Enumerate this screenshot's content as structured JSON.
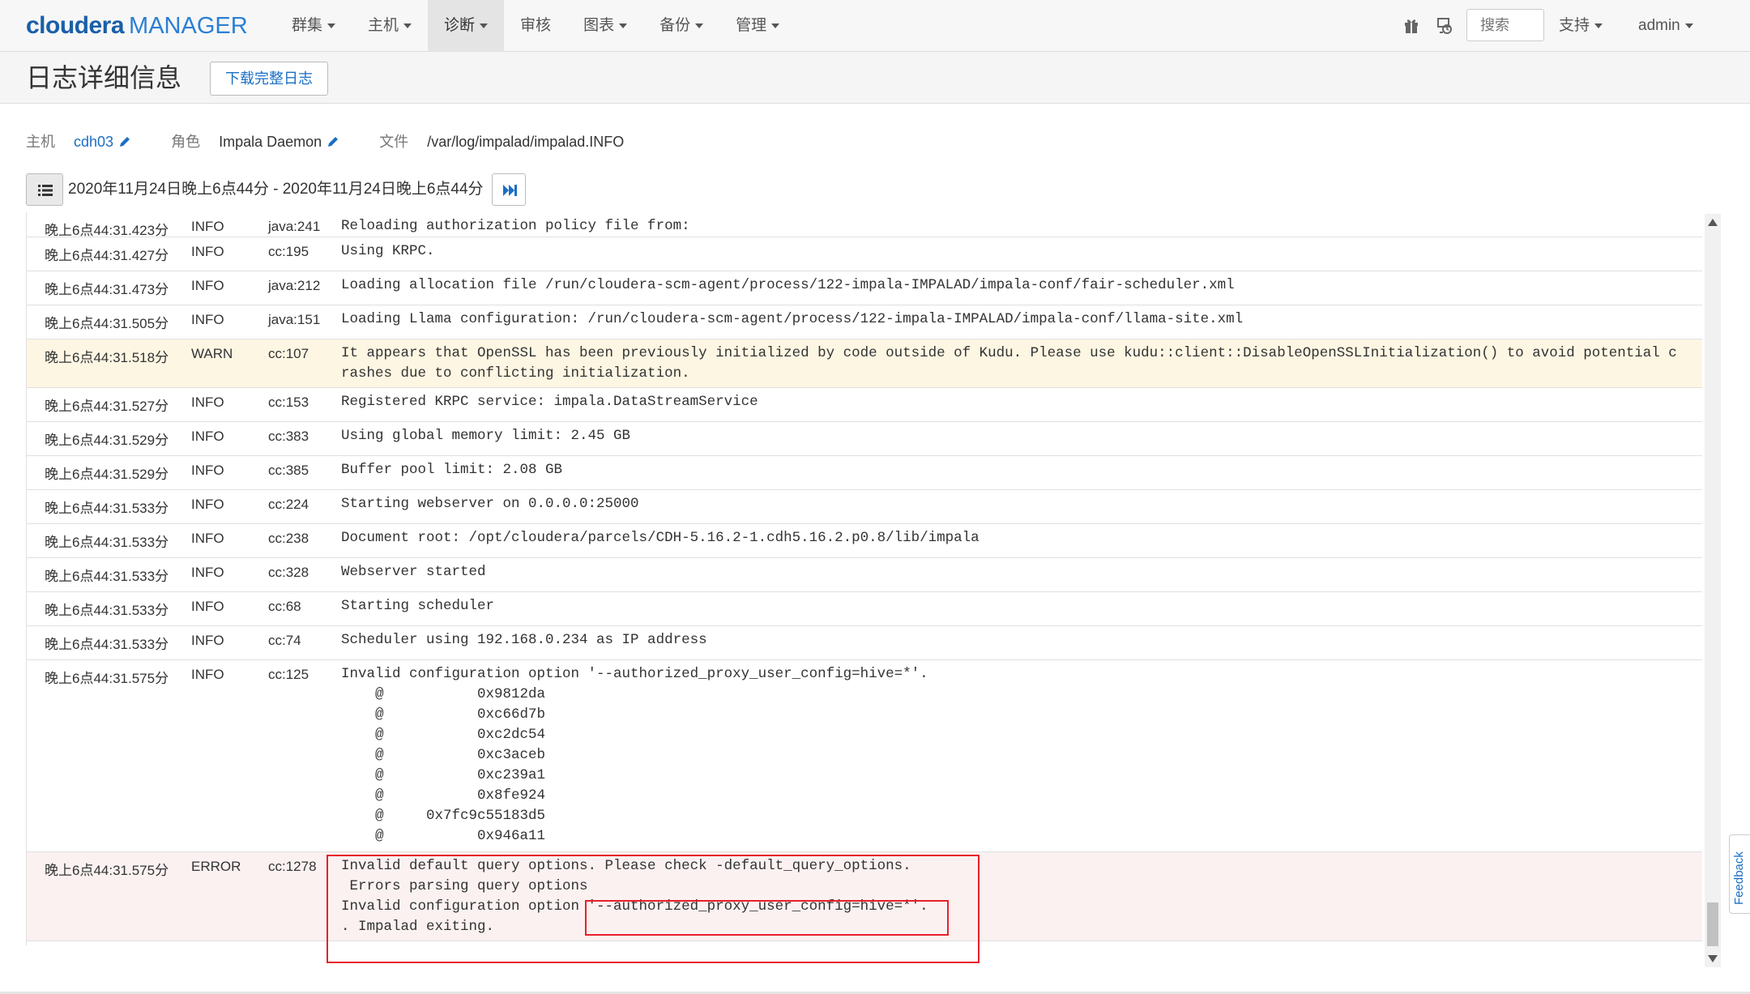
{
  "brand": {
    "cloudera": "cloudera",
    "manager": "MANAGER"
  },
  "nav": {
    "items": [
      {
        "label": "群集",
        "dropdown": true,
        "active": false
      },
      {
        "label": "主机",
        "dropdown": true,
        "active": false
      },
      {
        "label": "诊断",
        "dropdown": true,
        "active": true
      },
      {
        "label": "审核",
        "dropdown": false,
        "active": false
      },
      {
        "label": "图表",
        "dropdown": true,
        "active": false
      },
      {
        "label": "备份",
        "dropdown": true,
        "active": false
      },
      {
        "label": "管理",
        "dropdown": true,
        "active": false
      }
    ],
    "search_placeholder": "搜索",
    "support_label": "支持",
    "user_label": "admin"
  },
  "header": {
    "title": "日志详细信息",
    "download_label": "下载完整日志"
  },
  "context": {
    "host_label": "主机",
    "host_value": "cdh03",
    "role_label": "角色",
    "role_value": "Impala Daemon",
    "file_label": "文件",
    "file_value": "/var/log/impalad/impalad.INFO"
  },
  "range": {
    "text": "2020年11月24日晚上6点44分 - 2020年11月24日晚上6点44分"
  },
  "logs": [
    {
      "time": "晚上6点44:31.423分",
      "level": "INFO",
      "source": "java:241",
      "message": "Reloading authorization policy file from:",
      "h": 31
    },
    {
      "time": "晚上6点44:31.427分",
      "level": "INFO",
      "source": "cc:195",
      "message": "Using KRPC.",
      "h": 42
    },
    {
      "time": "晚上6点44:31.473分",
      "level": "INFO",
      "source": "java:212",
      "message": "Loading allocation file /run/cloudera-scm-agent/process/122-impala-IMPALAD/impala-conf/fair-scheduler.xml",
      "h": 42
    },
    {
      "time": "晚上6点44:31.505分",
      "level": "INFO",
      "source": "java:151",
      "message": "Loading Llama configuration: /run/cloudera-scm-agent/process/122-impala-IMPALAD/impala-conf/llama-site.xml",
      "h": 42
    },
    {
      "time": "晚上6点44:31.518分",
      "level": "WARN",
      "source": "cc:107",
      "message": "It appears that OpenSSL has been previously initialized by code outside of Kudu. Please use kudu::client::DisableOpenSSLInitialization() to avoid potential c\nrashes due to conflicting initialization.",
      "h": 60
    },
    {
      "time": "晚上6点44:31.527分",
      "level": "INFO",
      "source": "cc:153",
      "message": "Registered KRPC service: impala.DataStreamService",
      "h": 42
    },
    {
      "time": "晚上6点44:31.529分",
      "level": "INFO",
      "source": "cc:383",
      "message": "Using global memory limit: 2.45 GB",
      "h": 42
    },
    {
      "time": "晚上6点44:31.529分",
      "level": "INFO",
      "source": "cc:385",
      "message": "Buffer pool limit: 2.08 GB",
      "h": 42
    },
    {
      "time": "晚上6点44:31.533分",
      "level": "INFO",
      "source": "cc:224",
      "message": "Starting webserver on 0.0.0.0:25000",
      "h": 42
    },
    {
      "time": "晚上6点44:31.533分",
      "level": "INFO",
      "source": "cc:238",
      "message": "Document root: /opt/cloudera/parcels/CDH-5.16.2-1.cdh5.16.2.p0.8/lib/impala",
      "h": 42
    },
    {
      "time": "晚上6点44:31.533分",
      "level": "INFO",
      "source": "cc:328",
      "message": "Webserver started",
      "h": 42
    },
    {
      "time": "晚上6点44:31.533分",
      "level": "INFO",
      "source": "cc:68",
      "message": "Starting scheduler",
      "h": 42
    },
    {
      "time": "晚上6点44:31.533分",
      "level": "INFO",
      "source": "cc:74",
      "message": "Scheduler using 192.168.0.234 as IP address",
      "h": 42
    },
    {
      "time": "晚上6点44:31.575分",
      "level": "INFO",
      "source": "cc:125",
      "message": "Invalid configuration option '--authorized_proxy_user_config=hive=*'.\n    @           0x9812da\n    @           0xc66d7b\n    @           0xc2dc54\n    @           0xc3aceb\n    @           0xc239a1\n    @           0x8fe924\n    @     0x7fc9c55183d5\n    @           0x946a11",
      "h": 237
    },
    {
      "time": "晚上6点44:31.575分",
      "level": "ERROR",
      "source": "cc:1278",
      "message": "Invalid default query options. Please check -default_query_options.\n Errors parsing query options\nInvalid configuration option '--authorized_proxy_user_config=hive=*'.\n. Impalad exiting.",
      "h": 110
    }
  ],
  "feedback_label": "Feedback",
  "colors": {
    "brand": "#1a5fa8",
    "link": "#1a6fc4",
    "warn_row": "#fdf6e3",
    "error_row": "#fbf1f1",
    "annotation": "#e8202a"
  }
}
